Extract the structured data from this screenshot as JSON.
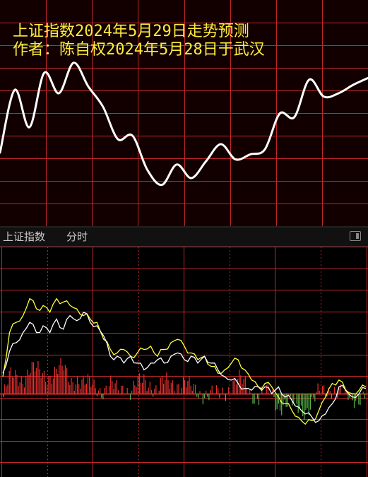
{
  "header": {
    "line1": "上证指数2024年5月29日走势预测",
    "line2": "作者：陈自权2024年5月28日于武汉"
  },
  "tabbar": {
    "index_name": "上证指数",
    "mode": "分时",
    "toggle_icon": "panel-toggle-icon"
  },
  "colors": {
    "grid": "#c0282b",
    "forecast_line": "#ffffff",
    "price_line": "#ffffff",
    "avg_line": "#ffff33",
    "up_bar": "#e8312f",
    "down_bar": "#55b447",
    "header_text": "#ffeb3b"
  },
  "chart_data": [
    {
      "type": "line",
      "series": [
        {
          "values": [
            0.35,
            0.72,
            0.5,
            0.82,
            0.7,
            0.88,
            0.74,
            0.62,
            0.43,
            0.45,
            0.25,
            0.16,
            0.28,
            0.2,
            0.3,
            0.4,
            0.31,
            0.34,
            0.37,
            0.58,
            0.56,
            0.78,
            0.68,
            0.7,
            0.75,
            0.79
          ]
        }
      ],
      "ylim": [
        0,
        1
      ],
      "grid": true
    },
    {
      "type": "line",
      "series": [
        {
          "values": [
            0.42,
            0.55,
            0.6,
            0.66,
            0.72,
            0.66,
            0.7,
            0.66,
            0.74,
            0.68,
            0.76,
            0.73,
            0.78,
            0.72,
            0.7,
            0.64,
            0.52,
            0.52,
            0.48,
            0.52,
            0.48,
            0.44,
            0.48,
            0.5,
            0.48,
            0.52,
            0.54,
            0.5,
            0.52,
            0.48,
            0.52,
            0.48,
            0.44,
            0.4,
            0.38,
            0.36,
            0.33,
            0.32,
            0.34,
            0.34,
            0.3,
            0.34,
            0.28,
            0.26,
            0.22,
            0.18,
            0.16,
            0.14,
            0.18,
            0.24,
            0.34,
            0.32,
            0.28,
            0.3,
            0.33
          ]
        },
        {
          "values": [
            0.4,
            0.66,
            0.72,
            0.76,
            0.86,
            0.8,
            0.82,
            0.78,
            0.86,
            0.84,
            0.82,
            0.8,
            0.76,
            0.74,
            0.72,
            0.62,
            0.56,
            0.54,
            0.56,
            0.52,
            0.54,
            0.56,
            0.58,
            0.52,
            0.56,
            0.6,
            0.62,
            0.58,
            0.54,
            0.5,
            0.52,
            0.46,
            0.42,
            0.44,
            0.48,
            0.5,
            0.44,
            0.38,
            0.34,
            0.36,
            0.34,
            0.28,
            0.24,
            0.2,
            0.16,
            0.12,
            0.14,
            0.2,
            0.28,
            0.36,
            0.38,
            0.32,
            0.3,
            0.32,
            0.34
          ]
        }
      ],
      "ylim": [
        0,
        1
      ],
      "grid": true
    }
  ]
}
